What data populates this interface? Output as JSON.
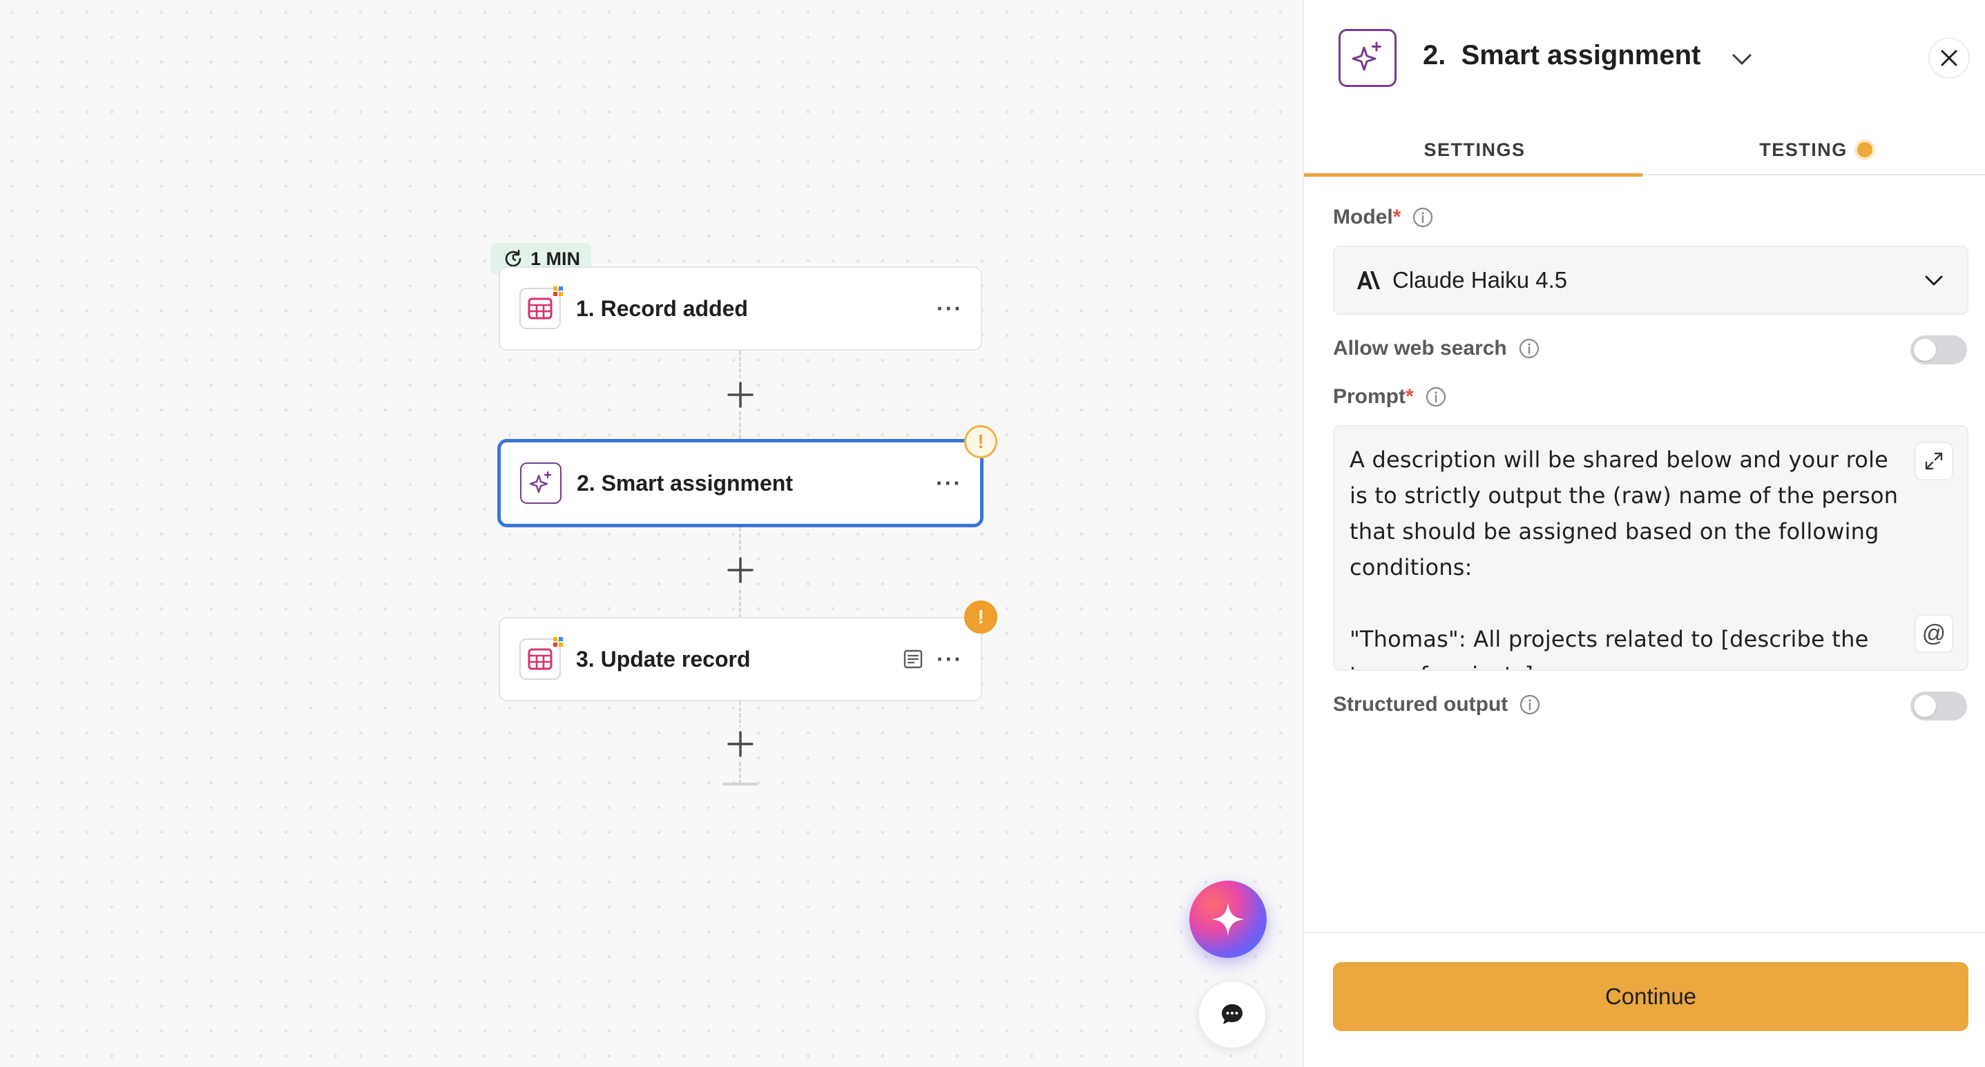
{
  "canvas": {
    "trigger_badge": "1 MIN",
    "steps": [
      {
        "title": "1. Record added",
        "icon": "table-icon",
        "selected": false,
        "warning": null
      },
      {
        "title": "2. Smart assignment",
        "icon": "sparkle-icon",
        "selected": true,
        "warning": "!"
      },
      {
        "title": "3. Update record",
        "icon": "table-icon",
        "selected": false,
        "warning": "!"
      }
    ],
    "more_label": "···"
  },
  "panel": {
    "title": "2.  Smart assignment",
    "tabs": [
      {
        "label": "SETTINGS",
        "active": true
      },
      {
        "label": "TESTING",
        "active": false,
        "status_dot": true
      }
    ],
    "model": {
      "label": "Model",
      "required_mark": "*",
      "value": "Claude Haiku 4.5"
    },
    "web_search": {
      "label": "Allow web search",
      "enabled": false
    },
    "prompt": {
      "label": "Prompt",
      "required_mark": "*",
      "text": "A description will be shared below and your role\nis to strictly output the (raw) name of the person\nthat should be assigned based on the following\nconditions:\n\n\"Thomas\": All projects related to [describe the\ntype of projects]",
      "mention_symbol": "@"
    },
    "structured_output": {
      "label": "Structured output",
      "enabled": false
    },
    "continue_label": "Continue"
  },
  "colors": {
    "accent": "#eaa83f",
    "selected_border": "#3b74d9",
    "warning": "#ee9f2e",
    "brand_purple": "#7a3b8f",
    "table_pink": "#d6336c"
  }
}
